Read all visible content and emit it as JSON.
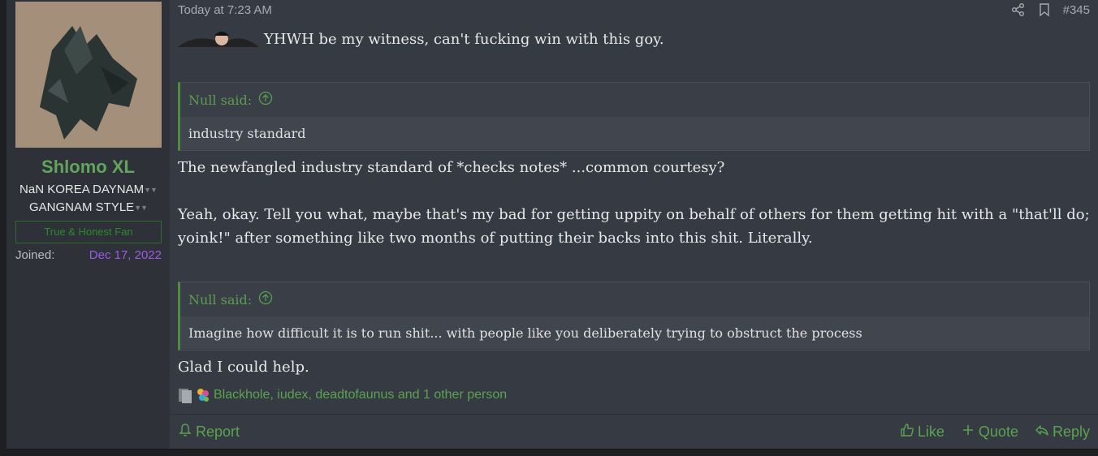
{
  "user": {
    "name": "Shlomo XL",
    "title_line1": "NaN KOREA DAYNAM",
    "title_line2": "GANGNAM STYLE",
    "banner": "True & Honest Fan",
    "joined_label": "Joined:",
    "joined_value": "Dec 17, 2022"
  },
  "post": {
    "timestamp": "Today at 7:23 AM",
    "number": "#345",
    "line1": "YHWH be my witness, can't fucking win with this goy.",
    "quote1": {
      "author": "Null said:",
      "text": "industry standard"
    },
    "para1": "The newfangled industry standard of *checks notes* ...common courtesy?",
    "para2a": "Yeah, okay. Tell you what, maybe that's my bad for getting uppity on behalf of others for them getting hit with a \"that'll do;",
    "para2b": "yoink!\" after something like two months of putting their backs into this shit. Literally.",
    "quote2": {
      "author": "Null said:",
      "text": "Imagine how difficult it is to run shit... with people like you deliberately trying to obstruct the process"
    },
    "para3": "Glad I could help.",
    "reactions": "Blackhole, iudex, deadtofaunus and 1 other person"
  },
  "footer": {
    "report": "Report",
    "like": "Like",
    "quote": "Quote",
    "reply": "Reply"
  },
  "colors": {
    "accent": "#5aa351",
    "joined": "#9b59e8",
    "background": "#363a42"
  }
}
